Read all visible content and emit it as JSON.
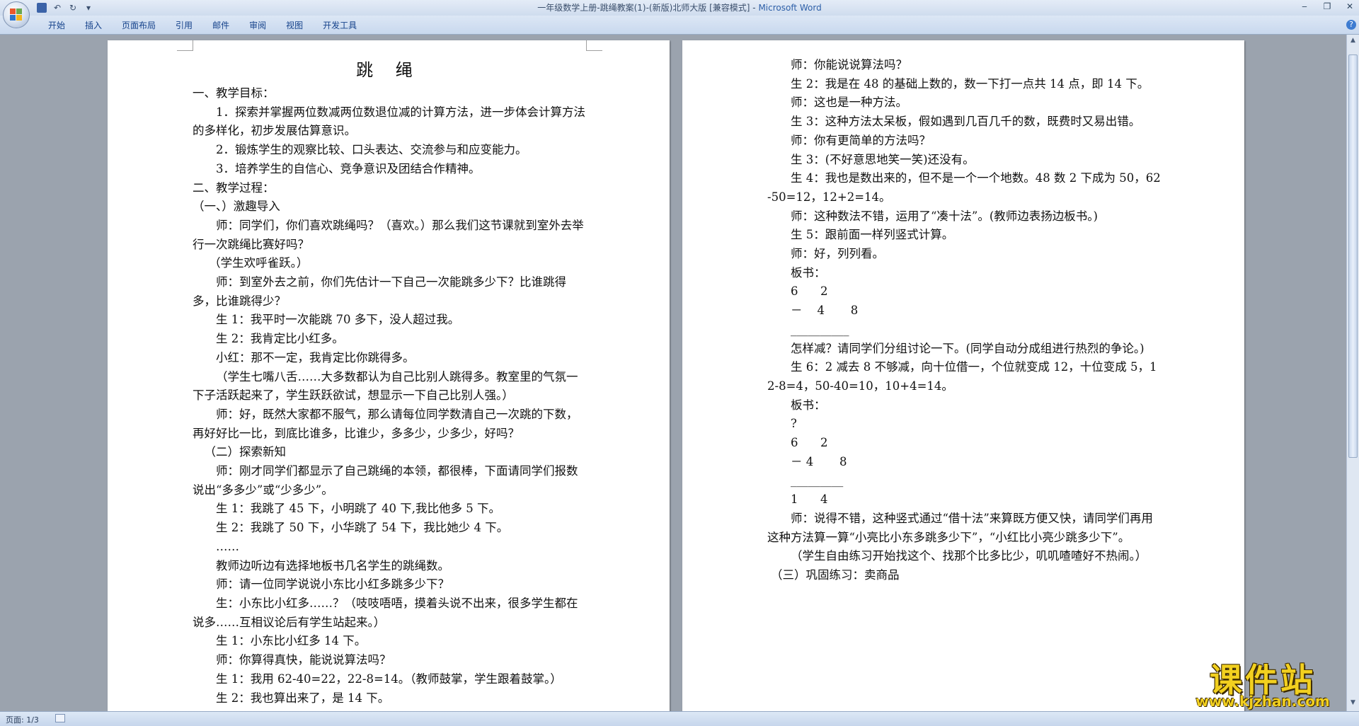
{
  "window": {
    "title_doc": "一年级数学上册-跳绳教案(1)-(新版)北师大版 [兼容模式] - ",
    "title_app": "Microsoft Word",
    "controls": [
      "‒",
      "❐",
      "✕"
    ]
  },
  "qat": {
    "undo": "↶",
    "redo": "↻",
    "more": "▾"
  },
  "ribbon": {
    "tabs": [
      "开始",
      "插入",
      "页面布局",
      "引用",
      "邮件",
      "审阅",
      "视图",
      "开发工具"
    ],
    "help": "?"
  },
  "document": {
    "title": "跳 绳",
    "left_page": [
      {
        "t": "一、教学目标：",
        "s": ""
      },
      {
        "t": "1．探索并掌握两位数减两位数退位减的计算方法，进一步体会计算方法的多样化，初步发展估算意识。",
        "s": "ind"
      },
      {
        "t": "2．锻炼学生的观察比较、口头表达、交流参与和应变能力。",
        "s": "ind"
      },
      {
        "t": "3．培养学生的自信心、竞争意识及团结合作精神。",
        "s": "ind"
      },
      {
        "t": "二、教学过程：",
        "s": ""
      },
      {
        "t": "（一、）激趣导入",
        "s": ""
      },
      {
        "t": "师：同学们，你们喜欢跳绳吗？（喜欢。）那么我们这节课就到室外去举行一次跳绳比赛好吗？",
        "s": "ind"
      },
      {
        "t": "（学生欢呼雀跃。）",
        "s": "ind15b"
      },
      {
        "t": "师：到室外去之前，你们先估计一下自己一次能跳多少下？比谁跳得多，比谁跳得少？",
        "s": "ind"
      },
      {
        "t": "生 1：我平时一次能跳 70 多下，没人超过我。",
        "s": "ind"
      },
      {
        "t": "生 2：我肯定比小红多。",
        "s": "ind"
      },
      {
        "t": "小红：那不一定，我肯定比你跳得多。",
        "s": "ind"
      },
      {
        "t": "（学生七嘴八舌……大多数都认为自己比别人跳得多。教室里的气氛一下子活跃起来了，学生跃跃欲试，想显示一下自己比别人强。）",
        "s": "ind"
      },
      {
        "t": "师：好，既然大家都不服气，那么请每位同学数清自己一次跳的下数，再好好比一比，到底比谁多，比谁少，多多少，少多少，好吗？",
        "s": "ind"
      },
      {
        "t": "（二）探索新知",
        "s": "ind1"
      },
      {
        "t": "师：刚才同学们都显示了自己跳绳的本领，都很棒，下面请同学们报数说出“多多少”或“少多少”。",
        "s": "ind"
      },
      {
        "t": "生 1：我跳了 45 下，小明跳了 40 下,我比他多 5 下。",
        "s": "ind"
      },
      {
        "t": "生 2：我跳了 50 下，小华跳了 54 下，我比她少 4 下。",
        "s": "ind"
      },
      {
        "t": "……",
        "s": "ind"
      },
      {
        "t": "教师边听边有选择地板书几名学生的跳绳数。",
        "s": "ind"
      },
      {
        "t": "师：请一位同学说说小东比小红多跳多少下？",
        "s": "ind"
      },
      {
        "t": "生：小东比小红多……？（吱吱唔唔，摸着头说不出来，很多学生都在说多……互相议论后有学生站起来。）",
        "s": "ind"
      },
      {
        "t": "生 1：小东比小红多 14 下。",
        "s": "ind"
      },
      {
        "t": "师：你算得真快，能说说算法吗？",
        "s": "ind"
      },
      {
        "t": "生 1：我用 62-40=22，22-8=14。（教师鼓掌，学生跟着鼓掌。）",
        "s": "ind"
      },
      {
        "t": "生 2：我也算出来了，是 14 下。",
        "s": "ind"
      }
    ],
    "right_page": [
      {
        "t": "师：你能说说算法吗？",
        "s": "ind"
      },
      {
        "t": "生 2：我是在 48 的基础上数的，数一下打一点共 14 点，即 14 下。",
        "s": "ind"
      },
      {
        "t": "师：这也是一种方法。",
        "s": "ind"
      },
      {
        "t": "生 3：这种方法太呆板，假如遇到几百几千的数，既费时又易出错。",
        "s": "ind"
      },
      {
        "t": "师：你有更简单的方法吗？",
        "s": "ind"
      },
      {
        "t": "生 3：(不好意思地笑一笑)还没有。",
        "s": "ind"
      },
      {
        "t": "生 4：我也是数出来的，但不是一个一个地数。48 数 2 下成为 50，62-50=12，12+2=14。",
        "s": "ind"
      },
      {
        "t": "师：这种数法不错，运用了“凑十法”。(教师边表扬边板书。)",
        "s": "ind"
      },
      {
        "t": "生 5：跟前面一样列竖式计算。",
        "s": "ind"
      },
      {
        "t": "师：好，列列看。",
        "s": "ind"
      },
      {
        "t": "板书：",
        "s": "ind"
      },
      {
        "t": "6      2",
        "s": "ind"
      },
      {
        "t": "－    4       8",
        "s": "ind"
      },
      {
        "t": "__________",
        "s": "ind"
      },
      {
        "t": "怎样减？请同学们分组讨论一下。(同学自动分成组进行热烈的争论。)",
        "s": "ind"
      },
      {
        "t": "生 6：2 减去 8 不够减，向十位借一，个位就变成 12，十位变成 5，12-8=4，50-40=10，10+4=14。",
        "s": "ind"
      },
      {
        "t": "板书：",
        "s": "ind"
      },
      {
        "t": "?",
        "s": "ind"
      },
      {
        "t": "6      2",
        "s": "ind"
      },
      {
        "t": "－ 4       8",
        "s": "ind"
      },
      {
        "t": "_________",
        "s": "ind"
      },
      {
        "t": "1      4",
        "s": "ind"
      },
      {
        "t": "师：说得不错，这种竖式通过“借十法”来算既方便又快，请同学们再用这种方法算一算“小亮比小东多跳多少下”，“小红比小亮少跳多少下”。",
        "s": "ind"
      },
      {
        "t": "（学生自由练习开始找这个、找那个比多比少，叽叽喳喳好不热闹。）",
        "s": "ind"
      },
      {
        "t": "（三）巩固练习：卖商品",
        "s": "ind15"
      }
    ]
  },
  "status": {
    "page": "页面: 1/3"
  },
  "watermark": {
    "main": "课件站",
    "sub": "www.kjzhan.com"
  }
}
